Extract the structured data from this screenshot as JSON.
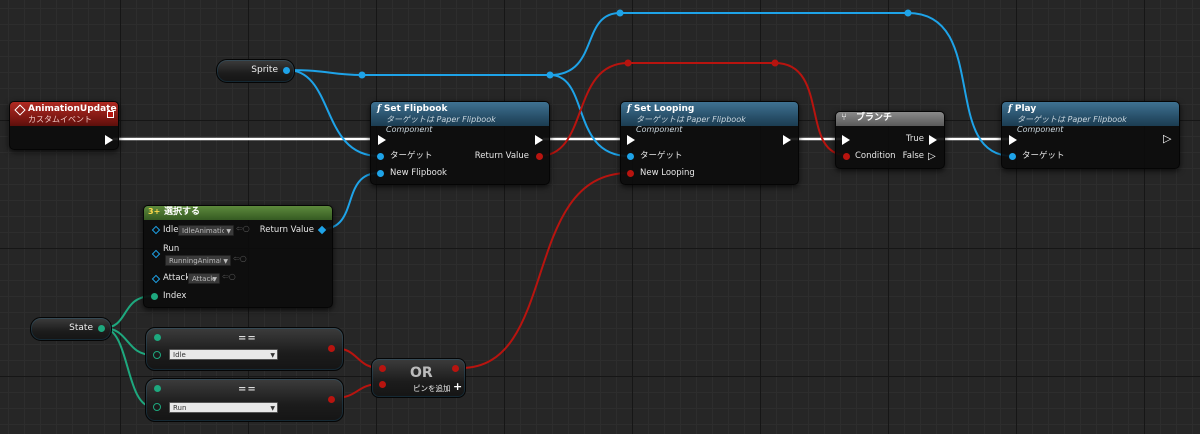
{
  "event_node": {
    "title": "AnimationUpdate",
    "subtitle": "カスタムイベント",
    "icon": "event-diamond-icon"
  },
  "sprite_var": {
    "label": "Sprite"
  },
  "state_var": {
    "label": "State"
  },
  "set_flipbook": {
    "title": "Set Flipbook",
    "subtitle": "ターゲットは Paper Flipbook Component",
    "pins": {
      "target": "ターゲット",
      "new_flipbook": "New Flipbook",
      "return_value": "Return Value"
    }
  },
  "set_looping": {
    "title": "Set Looping",
    "subtitle": "ターゲットは Paper Flipbook Component",
    "pins": {
      "target": "ターゲット",
      "new_looping": "New Looping"
    }
  },
  "branch": {
    "title": "ブランチ",
    "pins": {
      "condition": "Condition",
      "true": "True",
      "false": "False"
    }
  },
  "play": {
    "title": "Play",
    "subtitle": "ターゲットは Paper Flipbook Component",
    "pins": {
      "target": "ターゲット"
    }
  },
  "select": {
    "title": "選択する",
    "pins": {
      "idle": "Idle",
      "idle_value": "IdleAnimation",
      "run": "Run",
      "run_value": "RunningAnimatio",
      "attack": "Attack",
      "attack_value": "Attack",
      "index": "Index",
      "return_value": "Return Value"
    }
  },
  "eq1": {
    "symbol": "==",
    "value": "Idle"
  },
  "eq2": {
    "symbol": "==",
    "value": "Run"
  },
  "or_node": {
    "title": "OR",
    "add_pin": "ピンを追加",
    "add_icon": "plus-icon"
  },
  "colors": {
    "object_pin": "#1ea3e8",
    "bool_pin": "#b8140f",
    "enum_pin": "#1ea87e",
    "exec_wire": "#ffffff",
    "function_header": "#254b64",
    "event_header": "#7c1712"
  }
}
